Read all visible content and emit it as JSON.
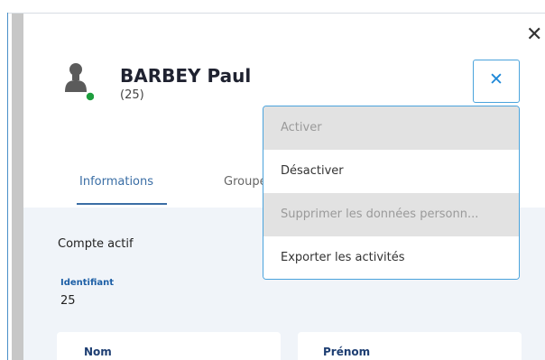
{
  "header": {
    "close_glyph": "✕",
    "user_name": "BARBEY Paul",
    "user_id": "(25)",
    "status_color": "#1e9e3e"
  },
  "tabs": [
    {
      "label": "Informations",
      "active": true
    },
    {
      "label": "Groupe",
      "active": false
    }
  ],
  "details": {
    "account_status": "Compte actif",
    "identifier_label": "Identifiant",
    "identifier_value": "25",
    "nom_label": "Nom",
    "prenom_label": "Prénom"
  },
  "actions_button": {
    "glyph": "✕"
  },
  "dropdown": {
    "items": [
      {
        "label": "Activer",
        "enabled": false
      },
      {
        "label": "Désactiver",
        "enabled": true
      },
      {
        "label": "Supprimer les données personn...",
        "enabled": false
      },
      {
        "label": "Exporter les activités",
        "enabled": true
      }
    ]
  },
  "colors": {
    "accent": "#1e88d8",
    "tab_active": "#3a6ea5",
    "label_blue": "#1d5fa6",
    "content_bg": "#f0f4f9",
    "disabled_bg": "#e2e2e2"
  }
}
